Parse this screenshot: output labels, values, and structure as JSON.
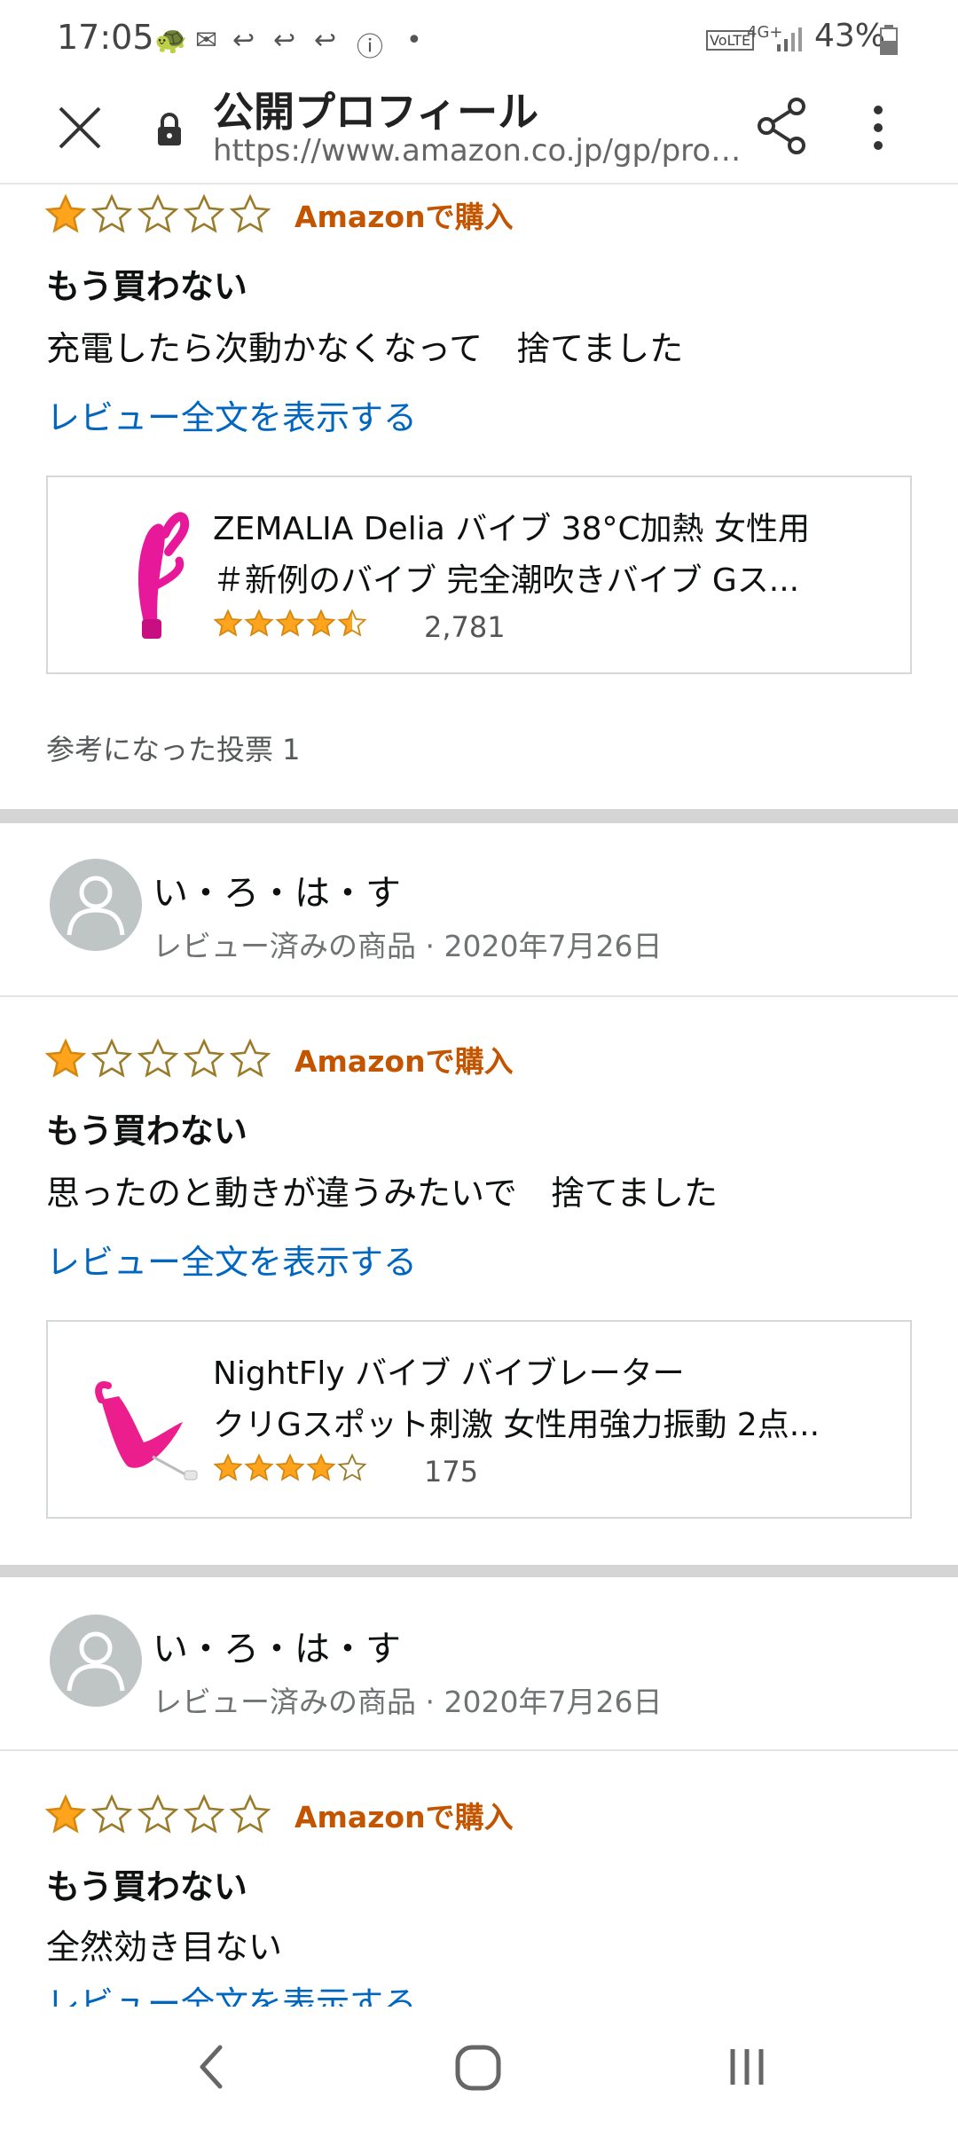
{
  "status_bar": {
    "time": "17:05",
    "battery": "43%",
    "icons": [
      "tortoise-icon",
      "mail-icon",
      "reply-icon",
      "reply-icon",
      "reply-icon",
      "info-icon",
      "dot-icon",
      "volte-icon",
      "4g-icon",
      "signal-icon",
      "battery-icon"
    ]
  },
  "toolbar": {
    "title": "公開プロフィール",
    "url": "https://www.amazon.co.jp/gp/profile/am...",
    "icons": [
      "close-icon",
      "lock-icon",
      "share-icon",
      "more-vert-icon"
    ]
  },
  "reviews": [
    {
      "rating": 1,
      "max_rating": 5,
      "badge": "Amazonで購入",
      "title": "もう買わない",
      "body": "充電したら次動かなくなって　捨てました",
      "link": "レビュー全文を表示する",
      "product": {
        "name_line1": "ZEMALIA Delia バイブ 38°C加熱 女性用",
        "name_line2": "＃新例のバイブ 完全潮吹きバイブ Gス...",
        "rating": 4.5,
        "count": "2,781",
        "image": "pink-rabbit-product-image"
      },
      "votes": "参考になった投票 1"
    },
    {
      "reviewer": "い・ろ・は・す",
      "meta": "レビュー済みの商品 · 2020年7月26日",
      "rating": 1,
      "max_rating": 5,
      "badge": "Amazonで購入",
      "title": "もう買わない",
      "body": "思ったのと動きが違うみたいで　捨てました",
      "link": "レビュー全文を表示する",
      "product": {
        "name_line1": "NightFly バイブ バイブレーター",
        "name_line2": "クリGスポット刺激 女性用強力振動 2点...",
        "rating": 4,
        "count": "175",
        "image": "pink-product-image"
      }
    },
    {
      "reviewer": "い・ろ・は・す",
      "meta": "レビュー済みの商品 · 2020年7月26日",
      "rating": 1,
      "max_rating": 5,
      "badge": "Amazonで購入",
      "title": "もう買わない",
      "body": "全然効き目ない",
      "link": "レビュー全文を表示する"
    }
  ],
  "nav_bar": {
    "icons": [
      "back-icon",
      "home-icon",
      "recents-icon"
    ]
  },
  "colors": {
    "star": "#ffa41c",
    "badge": "#c45500",
    "link": "#0066c0",
    "separator": "#d5d5d5"
  }
}
